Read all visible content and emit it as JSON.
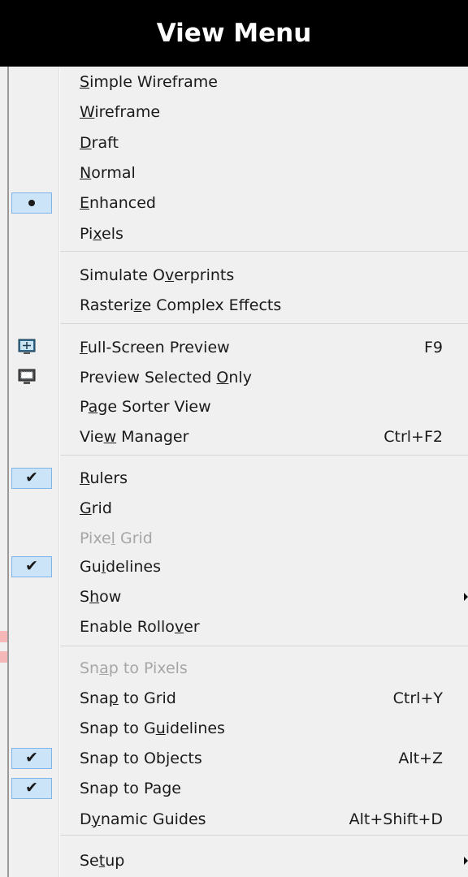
{
  "title": "View Menu",
  "items": [
    {
      "pre": "",
      "acc": "S",
      "post": "imple Wireframe",
      "shortcut": "",
      "state": "",
      "disabled": false,
      "submenu": false
    },
    {
      "pre": "",
      "acc": "W",
      "post": "ireframe",
      "shortcut": "",
      "state": "",
      "disabled": false,
      "submenu": false
    },
    {
      "pre": "",
      "acc": "D",
      "post": "raft",
      "shortcut": "",
      "state": "",
      "disabled": false,
      "submenu": false
    },
    {
      "pre": "",
      "acc": "N",
      "post": "ormal",
      "shortcut": "",
      "state": "",
      "disabled": false,
      "submenu": false
    },
    {
      "pre": "",
      "acc": "E",
      "post": "nhanced",
      "shortcut": "",
      "state": "selected-radio",
      "disabled": false,
      "submenu": false
    },
    {
      "pre": "Pi",
      "acc": "x",
      "post": "els",
      "shortcut": "",
      "state": "",
      "disabled": false,
      "submenu": false
    },
    {
      "pre": "Simulate O",
      "acc": "v",
      "post": "erprints",
      "shortcut": "",
      "state": "",
      "disabled": false,
      "submenu": false
    },
    {
      "pre": "Rasteri",
      "acc": "z",
      "post": "e Complex Effects",
      "shortcut": "",
      "state": "",
      "disabled": false,
      "submenu": false
    },
    {
      "pre": "",
      "acc": "F",
      "post": "ull-Screen Preview",
      "shortcut": "F9",
      "state": "",
      "disabled": false,
      "submenu": false,
      "icon": "fullscreen-preview-icon"
    },
    {
      "pre": "Preview Selected ",
      "acc": "O",
      "post": "nly",
      "shortcut": "",
      "state": "",
      "disabled": false,
      "submenu": false,
      "icon": "preview-selected-icon"
    },
    {
      "pre": "P",
      "acc": "a",
      "post": "ge Sorter View",
      "shortcut": "",
      "state": "",
      "disabled": false,
      "submenu": false
    },
    {
      "pre": "Vie",
      "acc": "w",
      "post": " Manager",
      "shortcut": "Ctrl+F2",
      "state": "",
      "disabled": false,
      "submenu": false
    },
    {
      "pre": "",
      "acc": "R",
      "post": "ulers",
      "shortcut": "",
      "state": "checked",
      "disabled": false,
      "submenu": false
    },
    {
      "pre": "",
      "acc": "G",
      "post": "rid",
      "shortcut": "",
      "state": "",
      "disabled": false,
      "submenu": false
    },
    {
      "pre": "Pixe",
      "acc": "l",
      "post": " Grid",
      "shortcut": "",
      "state": "",
      "disabled": true,
      "submenu": false
    },
    {
      "pre": "Gu",
      "acc": "i",
      "post": "delines",
      "shortcut": "",
      "state": "checked",
      "disabled": false,
      "submenu": false
    },
    {
      "pre": "S",
      "acc": "h",
      "post": "ow",
      "shortcut": "",
      "state": "",
      "disabled": false,
      "submenu": true
    },
    {
      "pre": "Enable Rollo",
      "acc": "v",
      "post": "er",
      "shortcut": "",
      "state": "",
      "disabled": false,
      "submenu": false
    },
    {
      "pre": "Sn",
      "acc": "a",
      "post": "p to Pixels",
      "shortcut": "",
      "state": "",
      "disabled": true,
      "submenu": false
    },
    {
      "pre": "Sna",
      "acc": "p",
      "post": " to Grid",
      "shortcut": "Ctrl+Y",
      "state": "",
      "disabled": false,
      "submenu": false
    },
    {
      "pre": "Snap to G",
      "acc": "u",
      "post": "idelines",
      "shortcut": "",
      "state": "",
      "disabled": false,
      "submenu": false
    },
    {
      "pre": "Snap to Objects",
      "acc": "",
      "post": "",
      "shortcut": "Alt+Z",
      "state": "checked",
      "disabled": false,
      "submenu": false
    },
    {
      "pre": "Snap to Page",
      "acc": "",
      "post": "",
      "shortcut": "",
      "state": "checked",
      "disabled": false,
      "submenu": false
    },
    {
      "pre": "D",
      "acc": "y",
      "post": "namic Guides",
      "shortcut": "Alt+Shift+D",
      "state": "",
      "disabled": false,
      "submenu": false
    },
    {
      "pre": "Se",
      "acc": "t",
      "post": "up",
      "shortcut": "",
      "state": "",
      "disabled": false,
      "submenu": true
    }
  ],
  "colors": {
    "title_bg": "#000000",
    "title_fg": "#ffffff",
    "menu_bg": "#f0f0f0",
    "check_bg": "#cce4f7",
    "check_border": "#7eb4ea",
    "disabled_text": "#a6a6a6"
  }
}
